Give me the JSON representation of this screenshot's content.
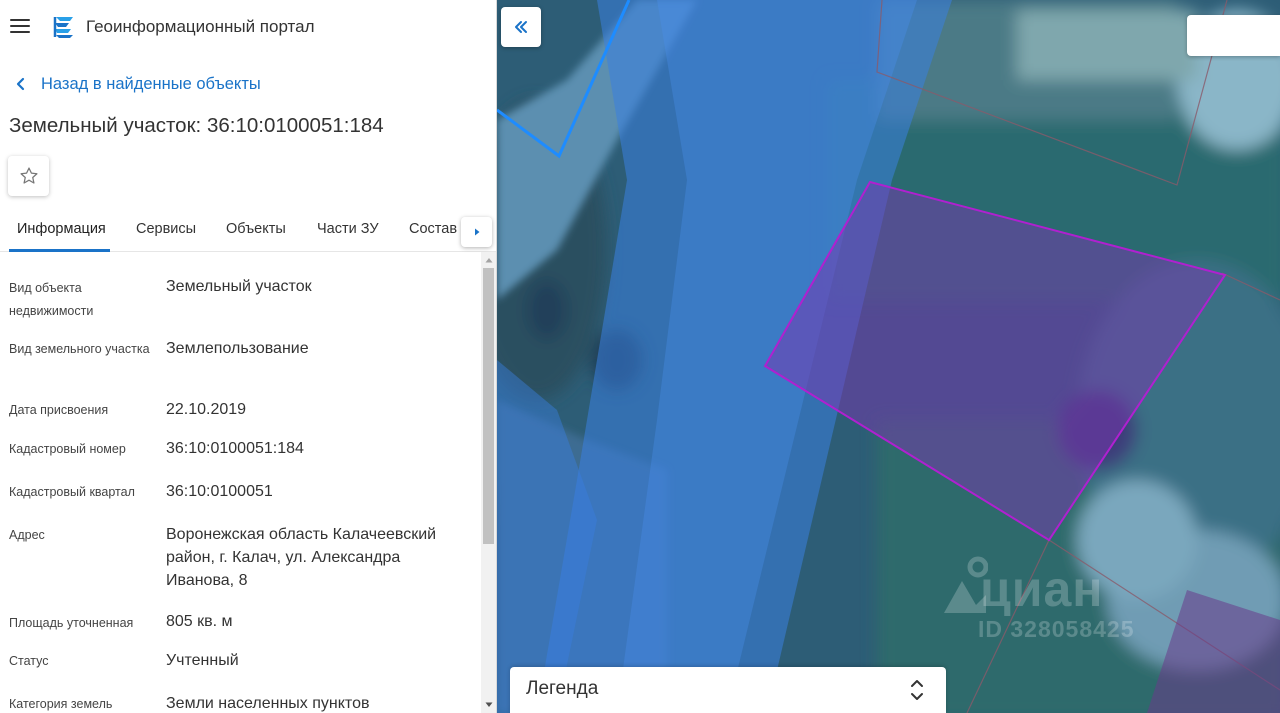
{
  "app": {
    "title": "Геоинформационный портал",
    "brand_color": "#1a73c8"
  },
  "nav": {
    "back_label": "Назад в найденные объекты"
  },
  "object": {
    "title": "Земельный участок: 36:10:0100051:184"
  },
  "tabs": [
    {
      "label": "Информация",
      "active": true
    },
    {
      "label": "Сервисы",
      "active": false
    },
    {
      "label": "Объекты",
      "active": false
    },
    {
      "label": "Части ЗУ",
      "active": false
    },
    {
      "label": "Состав",
      "active": false
    }
  ],
  "properties": [
    {
      "label": "Вид объекта недвижимости",
      "value": "Земельный участок"
    },
    {
      "label": "Вид земельного участка",
      "value": "Землепользование"
    },
    {
      "label": "Дата присвоения",
      "value": "22.10.2019"
    },
    {
      "label": "Кадастровый номер",
      "value": "36:10:0100051:184"
    },
    {
      "label": "Кадастровый квартал",
      "value": "36:10:0100051"
    },
    {
      "label": "Адрес",
      "value": "Воронежская область Калачеевский район, г. Калач, ул. Александра Иванова, 8"
    },
    {
      "label": "Площадь уточненная",
      "value": "805 кв. м"
    },
    {
      "label": "Статус",
      "value": "Учтенный"
    },
    {
      "label": "Категория земель",
      "value": "Земли населенных пунктов"
    }
  ],
  "map": {
    "watermark_brand": "циан",
    "watermark_id": "ID 328058425",
    "legend_label": "Легенда",
    "parcel_outline_color": "#b020d0",
    "zone_outline_color": "#1e8cff"
  },
  "icons": {
    "menu": "hamburger-menu-icon",
    "logo": "portal-logo-icon",
    "back": "chevron-left-icon",
    "favorite": "star-outline-icon",
    "tabs_next": "caret-right-icon",
    "collapse": "double-chevron-left-icon",
    "legend_toggle": "chevron-up-down-icon"
  }
}
